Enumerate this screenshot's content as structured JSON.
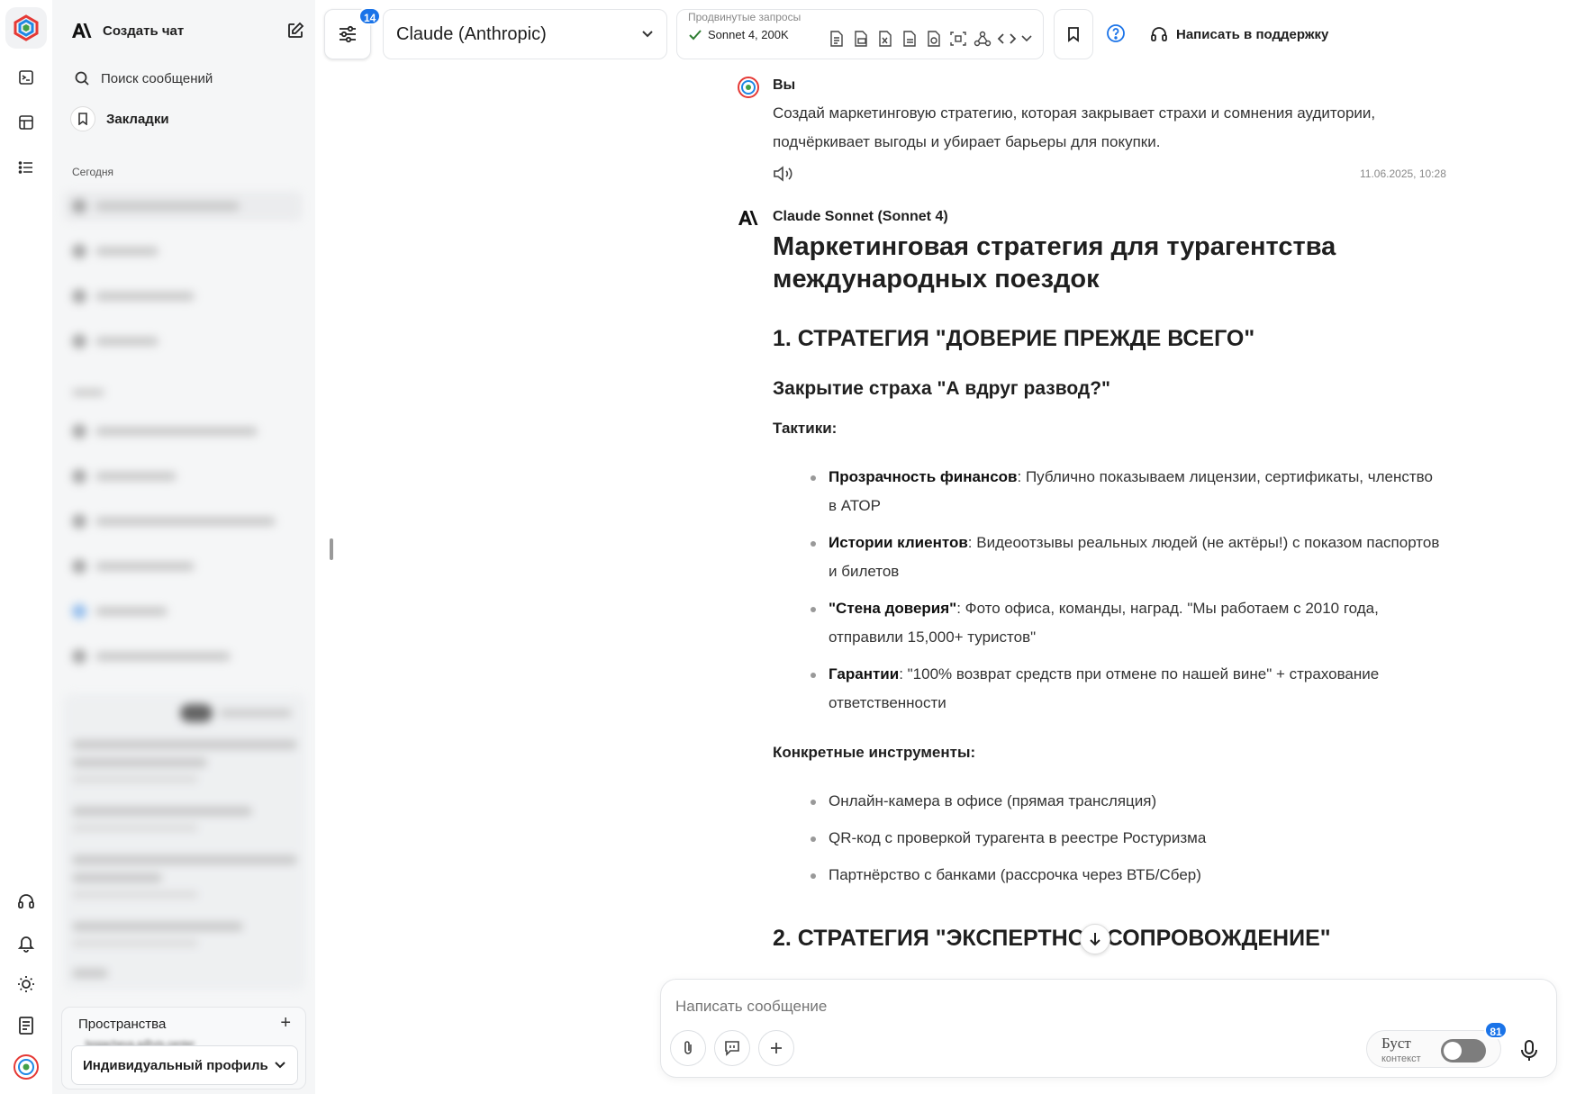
{
  "sidebar": {
    "new_chat": "Создать чат",
    "search": "Поиск сообщений",
    "bookmarks": "Закладки",
    "section_today": "Сегодня",
    "spaces_label": "Пространства",
    "spaces_email": "bogacheva.a@vis.center",
    "profile": "Индивидуальный профиль"
  },
  "toolbar": {
    "settings_badge": "14",
    "model": "Claude (Anthropic)",
    "advanced_label": "Продвинутые запросы",
    "advanced_value": "Sonnet 4, 200K",
    "support": "Написать в поддержку"
  },
  "conversation": {
    "user_name": "Вы",
    "user_text": "Создай маркетинговую стратегию, которая закрывает страхи и сомнения аудитории, подчёркивает выгоды и убирает барьеры для покупки.",
    "timestamp": "11.06.2025, 10:28",
    "ai_name": "Claude Sonnet (Sonnet 4)",
    "title": "Маркетинговая стратегия для турагентства международных поездок",
    "h2_1": "1. СТРАТЕГИЯ \"ДОВЕРИЕ ПРЕЖДЕ ВСЕГО\"",
    "h3_1": "Закрытие страха \"А вдруг развод?\"",
    "tactics_label": "Тактики:",
    "tactics": [
      {
        "bold": "Прозрачность финансов",
        "text": ": Публично показываем лицензии, сертификаты, членство в АТОР"
      },
      {
        "bold": "Истории клиентов",
        "text": ": Видеоотзывы реальных людей (не актёры!) с показом паспортов и билетов"
      },
      {
        "bold": "\"Стена доверия\"",
        "text": ": Фото офиса, команды, наград. \"Мы работаем с 2010 года, отправили 15,000+ туристов\""
      },
      {
        "bold": "Гарантии",
        "text": ": \"100% возврат средств при отмене по нашей вине\" + страхование ответственности"
      }
    ],
    "tools_label": "Конкретные инструменты:",
    "tools": [
      "Онлайн-камера в офисе (прямая трансляция)",
      "QR-код с проверкой турагента в реестре Ростуризма",
      "Партнёрство с банками (рассрочка через ВТБ/Сбер)"
    ],
    "h2_2": "2. СТРАТЕГИЯ \"ЭКСПЕРТНОЕ СОПРОВОЖДЕНИЕ\""
  },
  "composer": {
    "placeholder": "Написать сообщение",
    "boost_label": "Буст",
    "boost_sub": "контекст",
    "boost_badge": "81"
  }
}
